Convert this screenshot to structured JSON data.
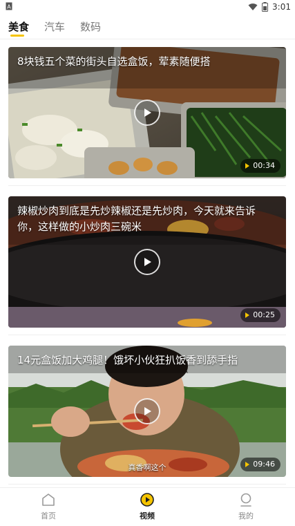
{
  "status_bar": {
    "time": "3:01",
    "left_icon": "a-notification-icon",
    "icons": [
      "wifi-icon",
      "battery-icon"
    ]
  },
  "tabs": [
    {
      "label": "美食",
      "active": true
    },
    {
      "label": "汽车",
      "active": false
    },
    {
      "label": "数码",
      "active": false
    }
  ],
  "videos": [
    {
      "title": "8块钱五个菜的街头自选盒饭，荤素随便搭",
      "duration": "00:34"
    },
    {
      "title": "辣椒炒肉到底是先炒辣椒还是先炒肉，今天就来告诉你，这样做的小炒肉三碗米",
      "duration": "00:25"
    },
    {
      "title": "14元盒饭加大鸡腿！饿坏小伙狂扒饭香到舔手指",
      "duration": "09:46",
      "caption": "真香啊这个"
    }
  ],
  "bottom_nav": [
    {
      "label": "首页",
      "icon": "home-icon",
      "active": false
    },
    {
      "label": "视频",
      "icon": "video-play-icon",
      "active": true
    },
    {
      "label": "我的",
      "icon": "profile-icon",
      "active": false
    }
  ],
  "colors": {
    "accent": "#f5c400",
    "text_primary": "#111111",
    "text_secondary": "#888888"
  }
}
